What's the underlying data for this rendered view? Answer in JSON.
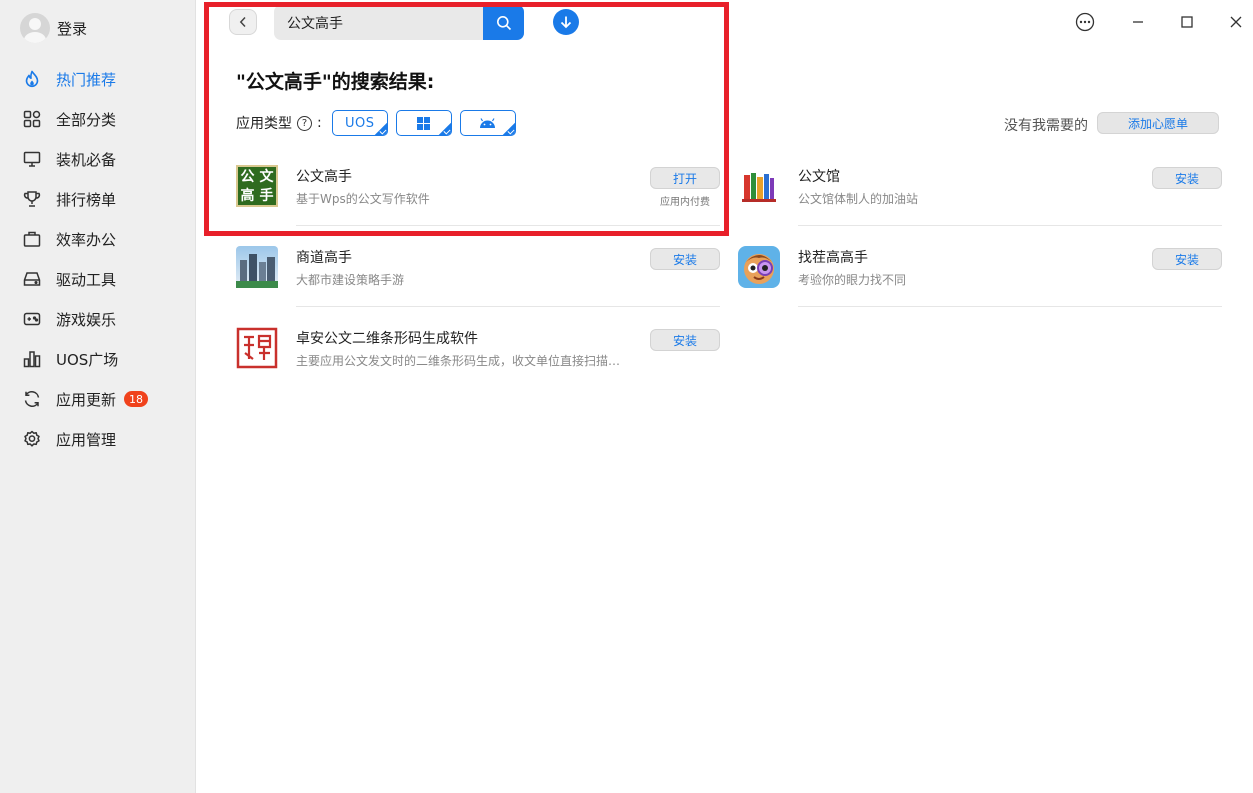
{
  "sidebar": {
    "login_label": "登录",
    "items": [
      {
        "label": "热门推荐",
        "icon": "flame-icon",
        "active": true
      },
      {
        "label": "全部分类",
        "icon": "grid-icon"
      },
      {
        "label": "装机必备",
        "icon": "monitor-icon"
      },
      {
        "label": "排行榜单",
        "icon": "trophy-icon"
      },
      {
        "label": "效率办公",
        "icon": "briefcase-icon"
      },
      {
        "label": "驱动工具",
        "icon": "drive-icon"
      },
      {
        "label": "游戏娱乐",
        "icon": "gamepad-icon"
      },
      {
        "label": "UOS广场",
        "icon": "chart-icon"
      },
      {
        "label": "应用更新",
        "icon": "refresh-icon",
        "badge": "18"
      },
      {
        "label": "应用管理",
        "icon": "gear-icon"
      }
    ]
  },
  "search": {
    "value": "公文高手"
  },
  "results": {
    "title": "\"公文高手\"的搜索结果:",
    "filter_label": "应用类型",
    "filter_colon": ":",
    "chips": [
      {
        "label": "UOS",
        "icon": "uos-icon"
      },
      {
        "label": "",
        "icon": "windows-icon"
      },
      {
        "label": "",
        "icon": "android-icon"
      }
    ],
    "wish_text": "没有我需要的",
    "wish_button": "添加心愿单"
  },
  "apps": [
    {
      "name": "公文高手",
      "desc": "基于Wps的公文写作软件",
      "button": "打开",
      "sub": "应用内付费",
      "icon_text": [
        "公",
        "文",
        "高",
        "手"
      ]
    },
    {
      "name": "公文馆",
      "desc": "公文馆体制人的加油站",
      "button": "安装"
    },
    {
      "name": "商道高手",
      "desc": "大都市建设策略手游",
      "button": "安装"
    },
    {
      "name": "找茬高高手",
      "desc": "考验你的眼力找不同",
      "button": "安装"
    },
    {
      "name": "卓安公文二维条形码生成软件",
      "desc": "主要应用公文发文时的二维条形码生成，收文单位直接扫描识别",
      "button": "安装"
    }
  ],
  "colors": {
    "accent": "#1a7ae8",
    "highlight": "#e8202a",
    "badge": "#f0421c"
  }
}
